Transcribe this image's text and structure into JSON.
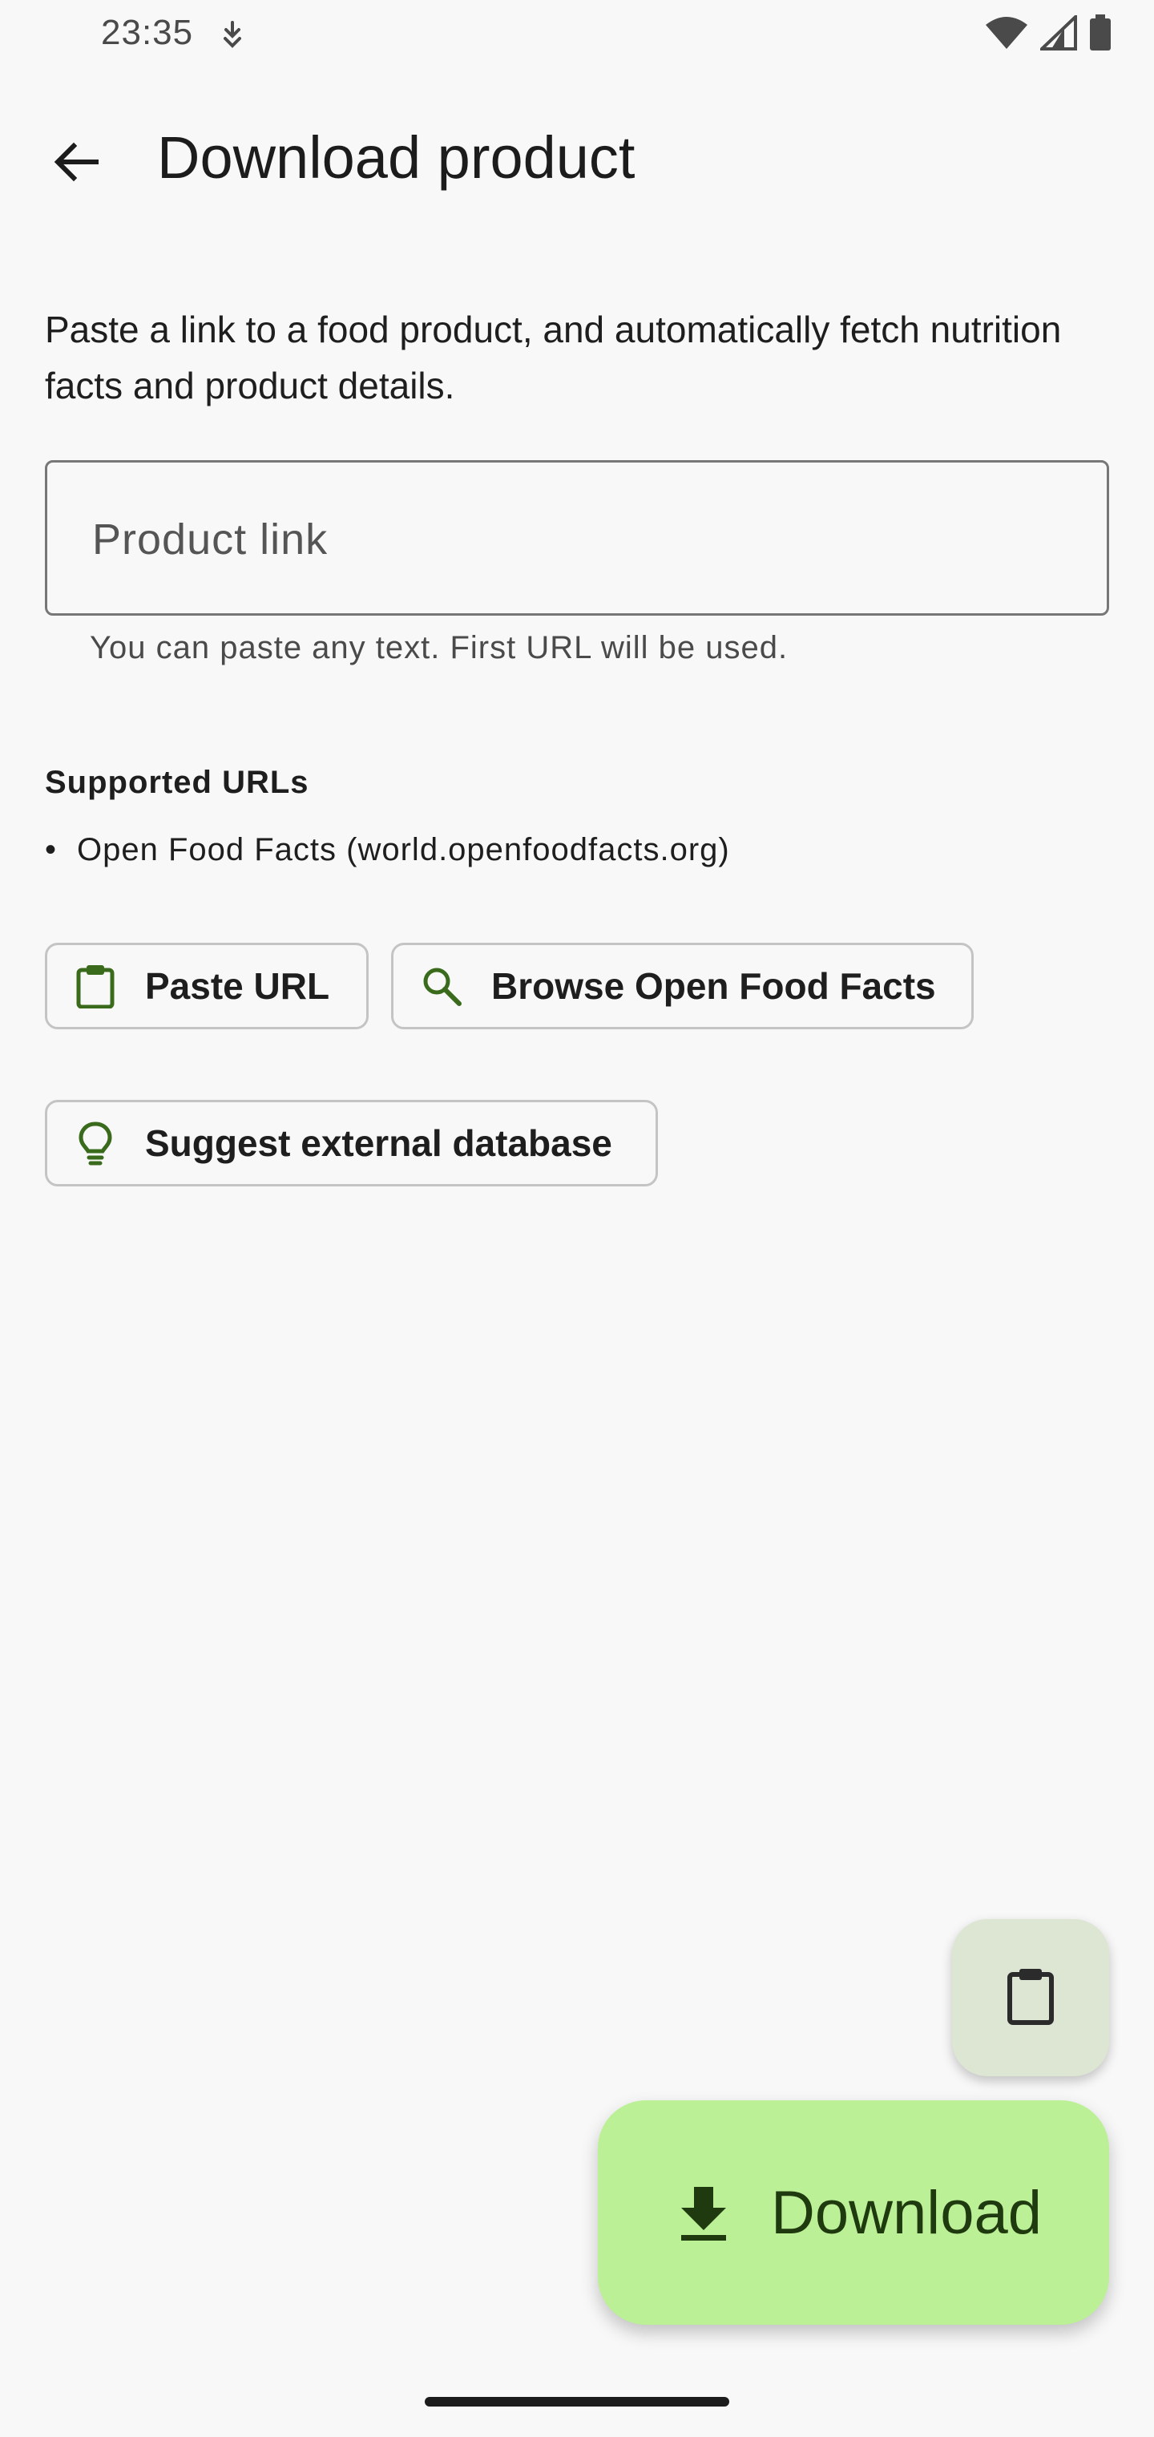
{
  "status_bar": {
    "time": "23:35",
    "icons": [
      "download-notification-icon",
      "wifi-icon",
      "cellular-signal-icon",
      "battery-icon"
    ]
  },
  "top_bar": {
    "title": "Download product",
    "back_icon": "arrow-back-icon"
  },
  "description": "Paste a link to a food product, and automatically fetch nutrition facts and product details.",
  "link_field": {
    "placeholder": "Product link",
    "value": "",
    "hint": "You can paste any text. First URL will be used."
  },
  "supported": {
    "heading": "Supported URLs",
    "items": [
      {
        "bullet": "•",
        "text": "Open Food Facts (world.openfoodfacts.org)"
      }
    ]
  },
  "chips": {
    "paste": {
      "label": "Paste URL",
      "icon": "clipboard-icon"
    },
    "browse": {
      "label": "Browse Open Food Facts",
      "icon": "search-icon"
    },
    "suggest": {
      "label": "Suggest external database",
      "icon": "lightbulb-icon"
    }
  },
  "fab": {
    "clipboard_icon": "clipboard-icon",
    "download_label": "Download",
    "download_icon": "download-icon"
  },
  "colors": {
    "background": "#f8f8f8",
    "accent_green": "#3a6b1c",
    "fab_download": "#bcf096",
    "fab_small": "#dde5d3"
  }
}
